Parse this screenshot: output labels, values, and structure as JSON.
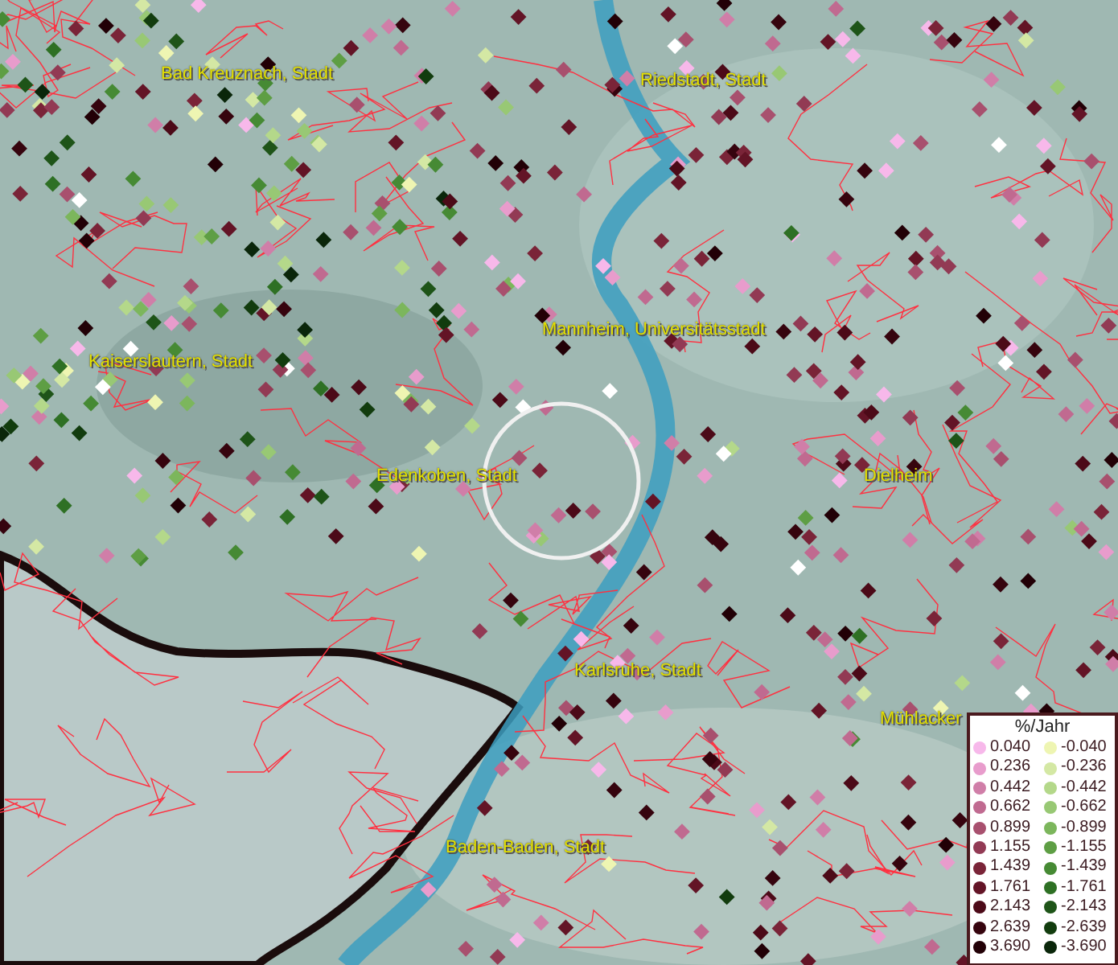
{
  "map": {
    "places": [
      {
        "name": "Bad Kreuznach, Stadt"
      },
      {
        "name": "Riedstadt, Stadt"
      },
      {
        "name": "Mannheim, Universitätsstadt"
      },
      {
        "name": "Kaiserslautern, Stadt"
      },
      {
        "name": "Edenkoben, Stadt"
      },
      {
        "name": "Dielheim"
      },
      {
        "name": "Karlsruhe, Stadt"
      },
      {
        "name": "Mühlacker"
      },
      {
        "name": "Baden-Baden, Stadt"
      }
    ]
  },
  "legend": {
    "title": "%/Jahr",
    "classes": [
      {
        "positive": {
          "label": "0.040",
          "color": "#f7b8ea"
        },
        "negative": {
          "label": "-0.040",
          "color": "#eef5b2"
        }
      },
      {
        "positive": {
          "label": "0.236",
          "color": "#e89ccc"
        },
        "negative": {
          "label": "-0.236",
          "color": "#d4e8a4"
        }
      },
      {
        "positive": {
          "label": "0.442",
          "color": "#d07ea8"
        },
        "negative": {
          "label": "-0.442",
          "color": "#b4d88a"
        }
      },
      {
        "positive": {
          "label": "0.662",
          "color": "#c06a90"
        },
        "negative": {
          "label": "-0.662",
          "color": "#98c874"
        }
      },
      {
        "positive": {
          "label": "0.899",
          "color": "#a8506e"
        },
        "negative": {
          "label": "-0.899",
          "color": "#7cb65c"
        }
      },
      {
        "positive": {
          "label": "1.155",
          "color": "#923a54"
        },
        "negative": {
          "label": "-1.155",
          "color": "#5e9e44"
        }
      },
      {
        "positive": {
          "label": "1.439",
          "color": "#7a2438"
        },
        "negative": {
          "label": "-1.439",
          "color": "#468a34"
        }
      },
      {
        "positive": {
          "label": "1.761",
          "color": "#631426"
        },
        "negative": {
          "label": "-1.761",
          "color": "#2e7024"
        }
      },
      {
        "positive": {
          "label": "2.143",
          "color": "#4c0a18"
        },
        "negative": {
          "label": "-2.143",
          "color": "#1e5418"
        }
      },
      {
        "positive": {
          "label": "2.639",
          "color": "#36040e"
        },
        "negative": {
          "label": "-2.639",
          "color": "#123c0e"
        }
      },
      {
        "positive": {
          "label": "3.690",
          "color": "#220006"
        },
        "negative": {
          "label": "-3.690",
          "color": "#0a260a"
        }
      }
    ]
  }
}
